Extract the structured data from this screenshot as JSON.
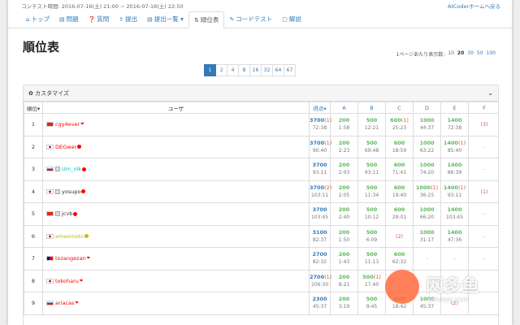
{
  "contest_time": "コンテスト時間: 2016-07-16(土) 21:00 ~ 2016-07-16(土) 22:50",
  "home_link": "AtCoderホームへ戻る",
  "nav": [
    {
      "name": "tab-top",
      "icon": "home-icon",
      "glyph": "⌂",
      "label": "トップ"
    },
    {
      "name": "tab-tasks",
      "icon": "list-icon",
      "glyph": "▤",
      "label": "問題"
    },
    {
      "name": "tab-questions",
      "icon": "question-icon",
      "glyph": "❓",
      "label": "質問"
    },
    {
      "name": "tab-submit",
      "icon": "upload-icon",
      "glyph": "⇪",
      "label": "提出"
    },
    {
      "name": "tab-submissions",
      "icon": "list-icon",
      "glyph": "▤",
      "label": "提出一覧 ▾"
    },
    {
      "name": "tab-standings",
      "icon": "sort-icon",
      "glyph": "⇅",
      "label": "順位表",
      "active": true
    },
    {
      "name": "tab-custom-test",
      "icon": "wrench-icon",
      "glyph": "✎",
      "label": "コードテスト"
    },
    {
      "name": "tab-editorial",
      "icon": "book-icon",
      "glyph": "▢",
      "label": "解説"
    }
  ],
  "page_title": "順位表",
  "per_page_label": "1ページあたり表示数:",
  "per_page_options": [
    "10",
    "20",
    "30",
    "50",
    "100"
  ],
  "per_page_selected": "20",
  "pages": [
    "1",
    "2",
    "4",
    "8",
    "16",
    "32",
    "64",
    "67"
  ],
  "current_page": "1",
  "customize_label": "✿ カスタマイズ",
  "headers": {
    "rank": "順位▾",
    "user": "ユーザ",
    "total": "得点▾",
    "tasks": [
      "A",
      "B",
      "C",
      "D",
      "E",
      "F"
    ]
  },
  "colors": {
    "accepted": "#5cb85c",
    "penalty": "#d9534f",
    "link": "#337ab7",
    "red_user": "#ff0000",
    "yellow_user": "#c0c000",
    "green_user": "#008000",
    "cyan_user": "#00c0c0"
  },
  "rows": [
    {
      "rank": "1",
      "flag": "cn",
      "badge": false,
      "user": "cgy4ever",
      "dot": "red-heart",
      "ucolor": "#ff0000",
      "total": {
        "s": "3700",
        "p": "(1)",
        "t": "72:38"
      },
      "cells": [
        {
          "s": "200",
          "t": "1:58"
        },
        {
          "s": "500",
          "t": "12:21"
        },
        {
          "s": "600",
          "p": "(1)",
          "t": "25:23"
        },
        {
          "s": "1000",
          "t": "44:37"
        },
        {
          "s": "1400",
          "t": "72:38"
        },
        {
          "p": "(3)"
        }
      ]
    },
    {
      "rank": "2",
      "flag": "jp",
      "badge": false,
      "user": "DEGwer",
      "dot": "red-dot",
      "ucolor": "#ff0000",
      "total": {
        "s": "3700",
        "p": "(1)",
        "t": "90:40"
      },
      "cells": [
        {
          "s": "200",
          "t": "2:23"
        },
        {
          "s": "500",
          "t": "69:48"
        },
        {
          "s": "600",
          "t": "18:59"
        },
        {
          "s": "1000",
          "t": "63:22"
        },
        {
          "s": "1400",
          "p": "(1)",
          "t": "85:40"
        },
        {
          "d": "-"
        }
      ]
    },
    {
      "rank": "3",
      "flag": "ru",
      "badge": true,
      "user": "Um_nik",
      "dot": "red-dot",
      "ucolor": "#00c0c0",
      "total": {
        "s": "3700",
        "t": "93:11"
      },
      "cells": [
        {
          "s": "200",
          "t": "2:03"
        },
        {
          "s": "500",
          "t": "93:11"
        },
        {
          "s": "600",
          "t": "71:41"
        },
        {
          "s": "1000",
          "t": "74:20"
        },
        {
          "s": "1400",
          "t": "86:39"
        },
        {
          "d": "-"
        }
      ]
    },
    {
      "rank": "4",
      "flag": "jp",
      "badge": true,
      "user": "yosupo",
      "dot": "red-dot",
      "ucolor": "#333333",
      "total": {
        "s": "3700",
        "p": "(2)",
        "t": "103:11"
      },
      "cells": [
        {
          "s": "200",
          "t": "2:05"
        },
        {
          "s": "500",
          "t": "11:34"
        },
        {
          "s": "600",
          "t": "19:40"
        },
        {
          "s": "1000",
          "p": "(1)",
          "t": "36:25"
        },
        {
          "s": "1400",
          "p": "(1)",
          "t": "93:11"
        },
        {
          "p": "(1)"
        }
      ]
    },
    {
      "rank": "5",
      "flag": "cn",
      "badge": true,
      "user": "jcvb",
      "dot": "red-dot",
      "ucolor": "#333333",
      "total": {
        "s": "3700",
        "t": "103:45"
      },
      "cells": [
        {
          "s": "200",
          "t": "2:40"
        },
        {
          "s": "500",
          "t": "10:12"
        },
        {
          "s": "600",
          "t": "29:01"
        },
        {
          "s": "1000",
          "t": "66:20"
        },
        {
          "s": "1400",
          "t": "103:45"
        },
        {
          "d": "-"
        }
      ]
    },
    {
      "rank": "6",
      "flag": "jp",
      "badge": false,
      "user": "emeometo",
      "dot": "yellow-dot",
      "ucolor": "#c0c000",
      "total": {
        "s": "3100",
        "t": "82:37"
      },
      "cells": [
        {
          "s": "200",
          "t": "1:50"
        },
        {
          "s": "500",
          "t": "6:09"
        },
        {
          "p": "(2)"
        },
        {
          "s": "1000",
          "t": "31:17"
        },
        {
          "s": "1400",
          "t": "47:36"
        },
        {
          "d": "-"
        }
      ]
    },
    {
      "rank": "7",
      "flag": "tw",
      "badge": false,
      "user": "tozangezan",
      "dot": "red-heart",
      "ucolor": "#ff0000",
      "total": {
        "s": "2700",
        "t": "82:32"
      },
      "cells": [
        {
          "s": "200",
          "t": "1:43"
        },
        {
          "s": "500",
          "t": "11:13"
        },
        {
          "s": "600",
          "t": "62:32"
        },
        {
          "d": "-"
        },
        {
          "d": "-"
        },
        {
          "d": "-"
        }
      ]
    },
    {
      "rank": "8",
      "flag": "jp",
      "badge": false,
      "user": "tokoharu",
      "dot": "red-heart",
      "ucolor": "#ff0000",
      "total": {
        "s": "2700",
        "p": "(1)",
        "t": "106:30"
      },
      "cells": [
        {
          "s": "200",
          "t": "8:21"
        },
        {
          "s": "500",
          "p": "(1)",
          "t": "17:40"
        },
        {
          "d": ""
        },
        {
          "d": ""
        },
        {
          "d": ""
        },
        {
          "d": ""
        }
      ]
    },
    {
      "rank": "9",
      "flag": "ru",
      "badge": false,
      "user": "ariacas",
      "dot": "red-heart",
      "ucolor": "#ff0000",
      "total": {
        "s": "2300",
        "t": "45:37"
      },
      "cells": [
        {
          "s": "200",
          "t": "3:19"
        },
        {
          "s": "500",
          "t": "9:45"
        },
        {
          "s": "600",
          "t": "18:42"
        },
        {
          "s": "1000",
          "t": "45:37"
        },
        {
          "p": "(2)"
        },
        {
          "d": ""
        }
      ]
    }
  ],
  "watermark": {
    "text": "网多鱼",
    "url": "wduoyu.com"
  }
}
